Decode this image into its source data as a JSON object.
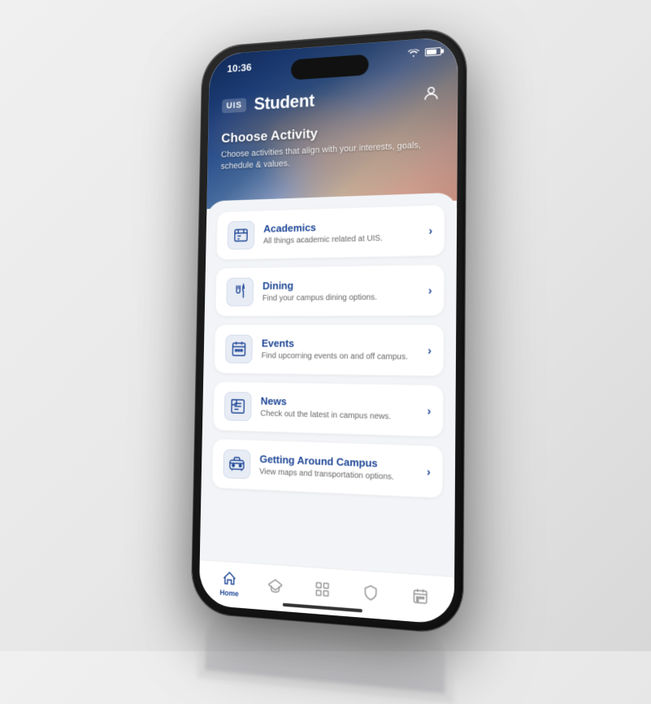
{
  "status_bar": {
    "time": "10:36",
    "wifi": "wifi",
    "battery": "battery"
  },
  "header": {
    "logo": "UIS",
    "title": "Student",
    "profile_icon": "person",
    "hero_title": "Choose Activity",
    "hero_subtitle": "Choose activities that align with your interests, goals, schedule & values."
  },
  "menu_items": [
    {
      "id": "academics",
      "label": "Academics",
      "description": "All things academic related at UIS.",
      "icon": "academics"
    },
    {
      "id": "dining",
      "label": "Dining",
      "description": "Find your campus dining options.",
      "icon": "dining"
    },
    {
      "id": "events",
      "label": "Events",
      "description": "Find upcoming events on and off campus.",
      "icon": "events"
    },
    {
      "id": "news",
      "label": "News",
      "description": "Check out the latest in campus news.",
      "icon": "news"
    },
    {
      "id": "getting-around",
      "label": "Getting Around Campus",
      "description": "View maps and transportation options.",
      "icon": "transit"
    }
  ],
  "bottom_nav": [
    {
      "id": "home",
      "label": "Home",
      "active": true
    },
    {
      "id": "academics",
      "label": "",
      "active": false
    },
    {
      "id": "apps",
      "label": "",
      "active": false
    },
    {
      "id": "shield",
      "label": "",
      "active": false
    },
    {
      "id": "calendar",
      "label": "",
      "active": false
    }
  ]
}
